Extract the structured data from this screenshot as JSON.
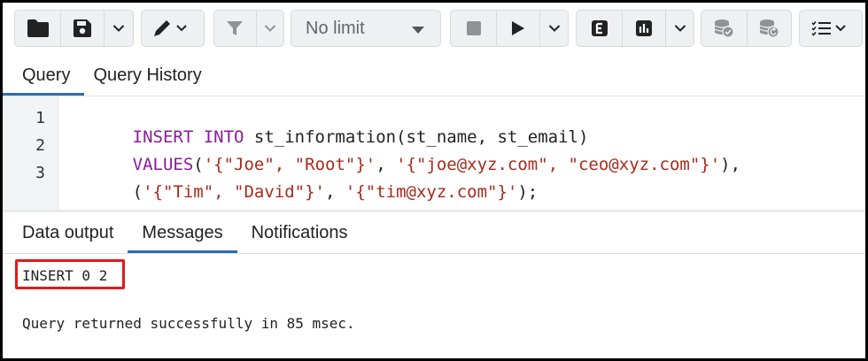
{
  "toolbar": {
    "limit_select_value": "No limit",
    "buttons": [
      {
        "name": "open-file-button",
        "icon": "folder-icon"
      },
      {
        "name": "save-button",
        "icon": "save-icon"
      },
      {
        "name": "save-options-dropdown",
        "icon": "chevron-down-icon"
      },
      {
        "name": "edit-button",
        "icon": "pencil-icon"
      },
      {
        "name": "filter-button",
        "icon": "filter-icon"
      },
      {
        "name": "filter-options-dropdown",
        "icon": "chevron-down-icon"
      },
      {
        "name": "stop-button",
        "icon": "stop-icon"
      },
      {
        "name": "execute-button",
        "icon": "play-icon"
      },
      {
        "name": "execute-options-dropdown",
        "icon": "chevron-down-icon"
      },
      {
        "name": "explain-button",
        "icon": "explain-icon"
      },
      {
        "name": "explain-analyze-button",
        "icon": "bar-chart-icon"
      },
      {
        "name": "explain-options-dropdown",
        "icon": "chevron-down-icon"
      },
      {
        "name": "commit-button",
        "icon": "database-check-icon"
      },
      {
        "name": "rollback-button",
        "icon": "database-rollback-icon"
      },
      {
        "name": "macros-button",
        "icon": "list-icon"
      }
    ]
  },
  "query_tabs": [
    {
      "label": "Query",
      "active": true
    },
    {
      "label": "Query History",
      "active": false
    }
  ],
  "editor": {
    "lines": [
      {
        "number": "1",
        "tokens": [
          {
            "t": "kw",
            "v": "INSERT INTO"
          },
          {
            "t": "plain",
            "v": " st_information(st_name, st_email)"
          }
        ]
      },
      {
        "number": "2",
        "tokens": [
          {
            "t": "kw",
            "v": "VALUES"
          },
          {
            "t": "plain",
            "v": "("
          },
          {
            "t": "str",
            "v": "'{\"Joe\", \"Root\"}'"
          },
          {
            "t": "plain",
            "v": ", "
          },
          {
            "t": "str",
            "v": "'{\"joe@xyz.com\", \"ceo@xyz.com\"}'"
          },
          {
            "t": "plain",
            "v": "),"
          }
        ]
      },
      {
        "number": "3",
        "tokens": [
          {
            "t": "plain",
            "v": "("
          },
          {
            "t": "str",
            "v": "'{\"Tim\", \"David\"}'"
          },
          {
            "t": "plain",
            "v": ", "
          },
          {
            "t": "str",
            "v": "'{\"tim@xyz.com\"}'"
          },
          {
            "t": "plain",
            "v": ");"
          }
        ]
      }
    ]
  },
  "result_tabs": [
    {
      "label": "Data output",
      "active": false
    },
    {
      "label": "Messages",
      "active": true
    },
    {
      "label": "Notifications",
      "active": false
    }
  ],
  "messages": {
    "result": "INSERT 0 2",
    "status": "Query returned successfully in 85 msec."
  },
  "colors": {
    "keyword": "#8b1a9a",
    "string": "#a82a1c",
    "active_tab_underline": "#2d6db5",
    "highlight_box": "#e01b1b"
  }
}
